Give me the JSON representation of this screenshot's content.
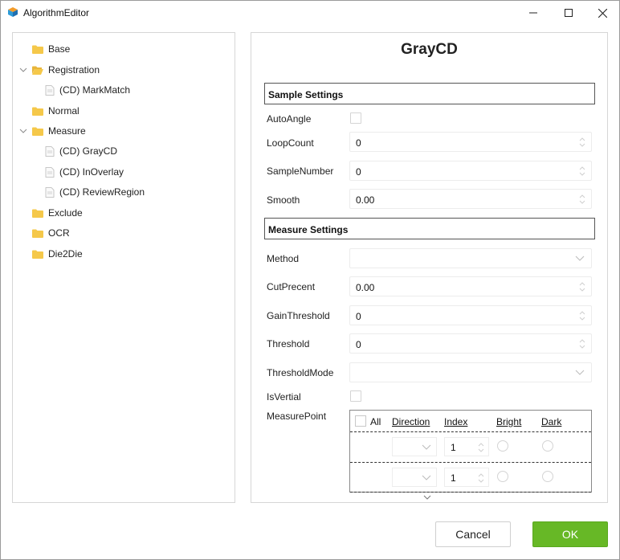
{
  "window": {
    "title": "AlgorithmEditor"
  },
  "tree": {
    "items": [
      {
        "label": "Base",
        "type": "folder",
        "level": 0,
        "expanded": false
      },
      {
        "label": "Registration",
        "type": "folder-open",
        "level": 0,
        "expanded": true
      },
      {
        "label": "(CD) MarkMatch",
        "type": "file",
        "level": 1
      },
      {
        "label": "Normal",
        "type": "folder",
        "level": 0,
        "expanded": false
      },
      {
        "label": "Measure",
        "type": "folder",
        "level": 0,
        "expanded": true
      },
      {
        "label": "(CD) GrayCD",
        "type": "file",
        "level": 1
      },
      {
        "label": "(CD) InOverlay",
        "type": "file",
        "level": 1
      },
      {
        "label": "(CD) ReviewRegion",
        "type": "file",
        "level": 1
      },
      {
        "label": "Exclude",
        "type": "folder",
        "level": 0,
        "expanded": false
      },
      {
        "label": "OCR",
        "type": "folder",
        "level": 0,
        "expanded": false
      },
      {
        "label": "Die2Die",
        "type": "folder",
        "level": 0,
        "expanded": false
      }
    ]
  },
  "properties": {
    "title": "GrayCD",
    "sample_settings": {
      "heading": "Sample Settings",
      "auto_angle_label": "AutoAngle",
      "loop_count_label": "LoopCount",
      "loop_count_value": "0",
      "sample_number_label": "SampleNumber",
      "sample_number_value": "0",
      "smooth_label": "Smooth",
      "smooth_value": "0.00"
    },
    "measure_settings": {
      "heading": "Measure Settings",
      "method_label": "Method",
      "method_value": "",
      "cut_precent_label": "CutPrecent",
      "cut_precent_value": "0.00",
      "gain_threshold_label": "GainThreshold",
      "gain_threshold_value": "0",
      "threshold_label": "Threshold",
      "threshold_value": "0",
      "threshold_mode_label": "ThresholdMode",
      "threshold_mode_value": "",
      "is_vertial_label": "IsVertial",
      "measure_point_label": "MeasurePoint"
    },
    "measure_point_grid": {
      "headers": {
        "all": "All",
        "direction": "Direction",
        "index": "Index",
        "bright": "Bright",
        "dark": "Dark"
      },
      "rows": [
        {
          "direction": "",
          "index": "1"
        },
        {
          "direction": "",
          "index": "1"
        }
      ]
    }
  },
  "buttons": {
    "cancel": "Cancel",
    "ok": "OK"
  },
  "colors": {
    "ok_green": "#67b826",
    "folder_yellow": "#f5c84a"
  }
}
